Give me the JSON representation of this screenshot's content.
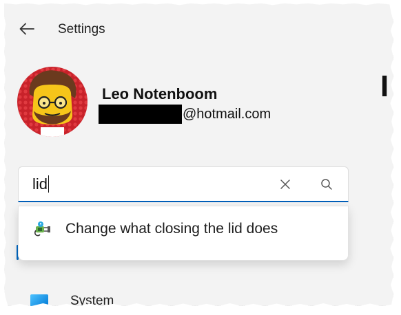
{
  "header": {
    "back_icon": "arrow-left-icon",
    "title": "Settings"
  },
  "profile": {
    "name": "Leo Notenboom",
    "email_suffix": "@hotmail.com",
    "avatar_icon": "lego-minifigure-avatar"
  },
  "search": {
    "value": "lid",
    "clear_icon": "close-icon",
    "search_icon": "search-icon",
    "accent_color": "#005fb8"
  },
  "suggestions": [
    {
      "label": "Change what closing the lid does",
      "icon": "power-plug-icon"
    }
  ],
  "nav": {
    "items": [
      {
        "label": "System",
        "icon": "system-icon"
      }
    ]
  }
}
